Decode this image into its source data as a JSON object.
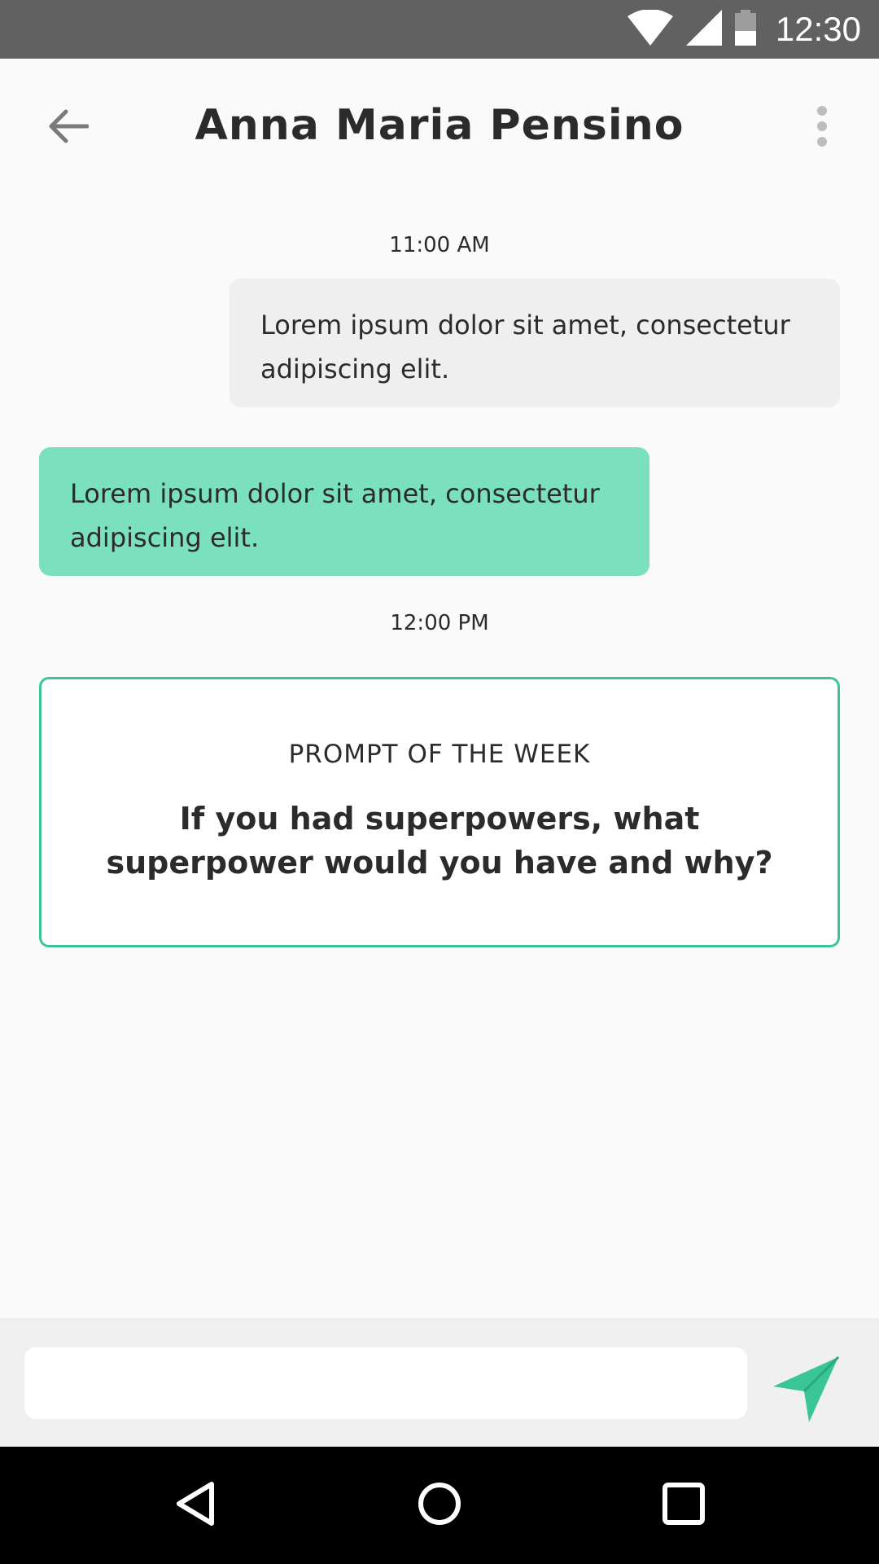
{
  "status_bar": {
    "time": "12:30",
    "icons": [
      "wifi-icon",
      "signal-icon",
      "battery-icon"
    ]
  },
  "toolbar": {
    "title": "Anna Maria Pensino",
    "back_icon": "arrow-left-icon",
    "menu_icon": "more-vertical-icon"
  },
  "chat": {
    "messages": [
      {
        "timestamp": "11:00 AM"
      },
      {
        "direction": "outgoing",
        "text": "Lorem ipsum dolor sit amet, consectetur adipiscing elit."
      },
      {
        "direction": "incoming",
        "text": "Lorem ipsum dolor sit amet, consectetur adipiscing elit."
      },
      {
        "timestamp": "12:00 PM"
      }
    ]
  },
  "prompt_card": {
    "label": "PROMPT OF THE WEEK",
    "question": "If you had superpowers, what superpower would you have and why?"
  },
  "composer": {
    "input_value": "",
    "send_icon": "send-icon"
  },
  "nav_bar": {
    "icons": [
      "back-triangle-icon",
      "home-circle-icon",
      "recents-square-icon"
    ]
  },
  "colors": {
    "status_bar": "#616161",
    "background": "#fafafa",
    "accent": "#39c596",
    "incoming_bubble": "#7ae0bd",
    "outgoing_bubble": "#efefef",
    "nav_bar": "#000000"
  }
}
